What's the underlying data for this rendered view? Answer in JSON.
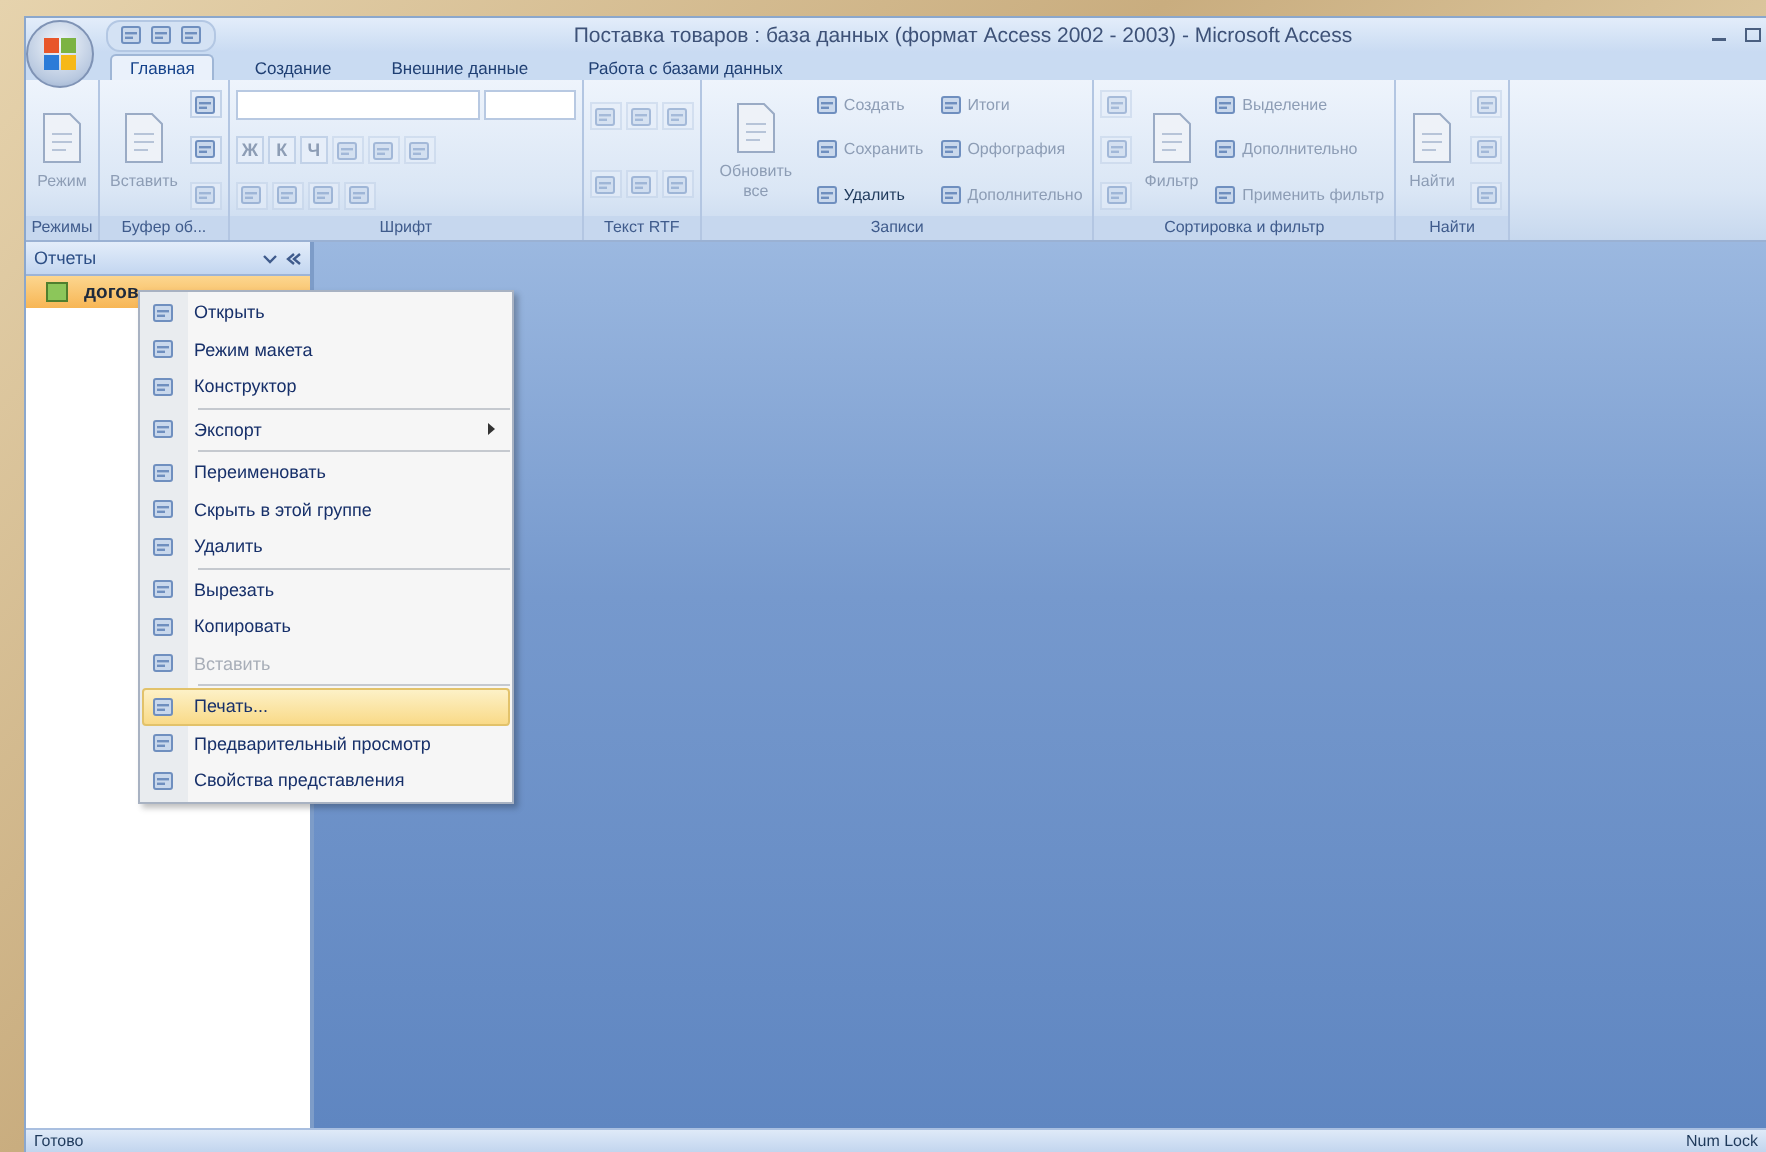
{
  "window": {
    "title": "Поставка товаров : база данных (формат Access 2002 - 2003) - Microsoft Access"
  },
  "tabs": [
    {
      "label": "Главная",
      "selected": true
    },
    {
      "label": "Создание",
      "selected": false
    },
    {
      "label": "Внешние данные",
      "selected": false
    },
    {
      "label": "Работа с базами данных",
      "selected": false
    }
  ],
  "ribbon": {
    "groups": [
      {
        "label": "Режимы",
        "columns": [
          [
            {
              "kind": "large",
              "label": "Режим",
              "disabled": true
            }
          ]
        ]
      },
      {
        "label": "Буфер об...",
        "columns": [
          [
            {
              "kind": "large",
              "label": "Вставить",
              "disabled": true
            }
          ],
          [
            {
              "kind": "icon",
              "disabled": false
            },
            {
              "kind": "icon",
              "disabled": false
            },
            {
              "kind": "icon",
              "disabled": true
            }
          ]
        ]
      },
      {
        "label": "Шрифт",
        "columns": [
          [
            {
              "kind": "row",
              "items": [
                {
                  "kind": "dropdown"
                },
                {
                  "kind": "dropdown"
                }
              ]
            },
            {
              "kind": "row",
              "items": [
                {
                  "kind": "glyph",
                  "label": "Ж",
                  "disabled": true
                },
                {
                  "kind": "glyph",
                  "label": "К",
                  "disabled": true
                },
                {
                  "kind": "glyph",
                  "label": "Ч",
                  "disabled": true
                },
                {
                  "kind": "icon",
                  "disabled": true
                },
                {
                  "kind": "icon",
                  "disabled": true
                },
                {
                  "kind": "icon",
                  "disabled": true
                }
              ]
            },
            {
              "kind": "row",
              "items": [
                {
                  "kind": "icon",
                  "disabled": true
                },
                {
                  "kind": "icon",
                  "disabled": true
                },
                {
                  "kind": "icon",
                  "disabled": true
                },
                {
                  "kind": "icon",
                  "disabled": true
                }
              ]
            }
          ]
        ]
      },
      {
        "label": "Текст RTF",
        "columns": [
          [
            {
              "kind": "row",
              "items": [
                {
                  "kind": "icon",
                  "disabled": true
                },
                {
                  "kind": "icon",
                  "disabled": true
                },
                {
                  "kind": "icon",
                  "disabled": true
                }
              ]
            },
            {
              "kind": "row",
              "items": [
                {
                  "kind": "icon",
                  "disabled": true
                },
                {
                  "kind": "icon",
                  "disabled": true
                },
                {
                  "kind": "icon",
                  "disabled": true
                }
              ]
            }
          ]
        ]
      },
      {
        "label": "Записи",
        "columns": [
          [
            {
              "kind": "large",
              "label": "Обновить все",
              "disabled": true
            }
          ],
          [
            {
              "kind": "small",
              "label": "Создать",
              "disabled": true
            },
            {
              "kind": "small",
              "label": "Сохранить",
              "disabled": true
            },
            {
              "kind": "small",
              "label": "Удалить",
              "disabled": false
            }
          ],
          [
            {
              "kind": "small",
              "label": "Итоги",
              "disabled": true
            },
            {
              "kind": "small",
              "label": "Орфография",
              "disabled": true
            },
            {
              "kind": "small",
              "label": "Дополнительно",
              "disabled": true
            }
          ]
        ]
      },
      {
        "label": "Сортировка и фильтр",
        "columns": [
          [
            {
              "kind": "icon",
              "disabled": true
            },
            {
              "kind": "icon",
              "disabled": true
            },
            {
              "kind": "icon",
              "disabled": true
            }
          ],
          [
            {
              "kind": "large",
              "label": "Фильтр",
              "disabled": true
            }
          ],
          [
            {
              "kind": "small",
              "label": "Выделение",
              "disabled": true
            },
            {
              "kind": "small",
              "label": "Дополнительно",
              "disabled": true
            },
            {
              "kind": "small",
              "label": "Применить фильтр",
              "disabled": true
            }
          ]
        ]
      },
      {
        "label": "Найти",
        "columns": [
          [
            {
              "kind": "large",
              "label": "Найти",
              "disabled": true
            }
          ],
          [
            {
              "kind": "icon",
              "disabled": true
            },
            {
              "kind": "icon",
              "disabled": true
            },
            {
              "kind": "icon",
              "disabled": true
            }
          ]
        ]
      }
    ]
  },
  "nav_pane": {
    "title": "Отчеты",
    "items": [
      {
        "label": "догов",
        "selected": true
      }
    ]
  },
  "context_menu": {
    "sections": [
      [
        {
          "label": "Открыть",
          "disabled": false,
          "selected": false,
          "submenu": false
        },
        {
          "label": "Режим макета",
          "disabled": false,
          "selected": false,
          "submenu": false
        },
        {
          "label": "Конструктор",
          "disabled": false,
          "selected": false,
          "submenu": false
        }
      ],
      [
        {
          "label": "Экспорт",
          "disabled": false,
          "selected": false,
          "submenu": true
        }
      ],
      [
        {
          "label": "Переименовать",
          "disabled": false,
          "selected": false,
          "submenu": false
        },
        {
          "label": "Скрыть в этой группе",
          "disabled": false,
          "selected": false,
          "submenu": false
        },
        {
          "label": "Удалить",
          "disabled": false,
          "selected": false,
          "submenu": false
        }
      ],
      [
        {
          "label": "Вырезать",
          "disabled": false,
          "selected": false,
          "submenu": false
        },
        {
          "label": "Копировать",
          "disabled": false,
          "selected": false,
          "submenu": false
        },
        {
          "label": "Вставить",
          "disabled": true,
          "selected": false,
          "submenu": false
        }
      ],
      [
        {
          "label": "Печать...",
          "disabled": false,
          "selected": true,
          "submenu": false
        },
        {
          "label": "Предварительный просмотр",
          "disabled": false,
          "selected": false,
          "submenu": false
        },
        {
          "label": "Свойства представления",
          "disabled": false,
          "selected": false,
          "submenu": false
        }
      ]
    ]
  },
  "status_bar": {
    "left": "Готово",
    "right": "Num Lock"
  }
}
